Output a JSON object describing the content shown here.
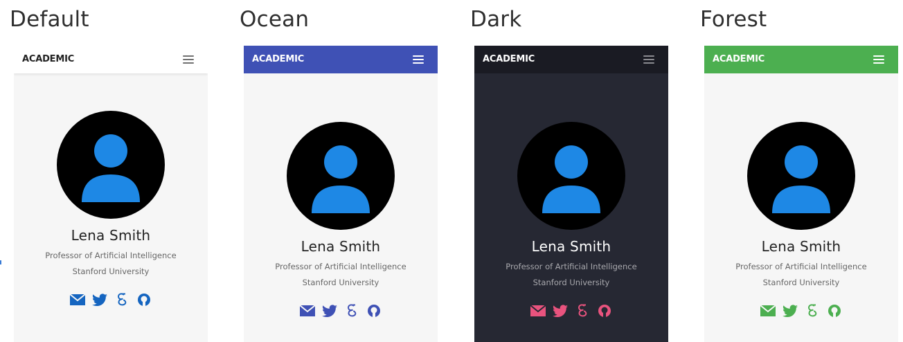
{
  "themes": [
    {
      "title": "Default",
      "brand": "ACADEMIC",
      "name": "Lena Smith",
      "role": "Professor of Artificial Intelligence",
      "organization": "Stanford University",
      "accent_color": "#1565c0",
      "navbar_color": "#ffffff",
      "background_color": "#f6f6f6",
      "social_icons": [
        "envelope-icon",
        "twitter-icon",
        "google-scholar-icon",
        "github-icon"
      ]
    },
    {
      "title": "Ocean",
      "brand": "ACADEMIC",
      "name": "Lena Smith",
      "role": "Professor of Artificial Intelligence",
      "organization": "Stanford University",
      "accent_color": "#3f51b5",
      "navbar_color": "#3f51b5",
      "background_color": "#f6f6f6",
      "social_icons": [
        "envelope-icon",
        "twitter-icon",
        "google-scholar-icon",
        "github-icon"
      ]
    },
    {
      "title": "Dark",
      "brand": "ACADEMIC",
      "name": "Lena Smith",
      "role": "Professor of Artificial Intelligence",
      "organization": "Stanford University",
      "accent_color": "#e9537e",
      "navbar_color": "#1a1b23",
      "background_color": "#262833",
      "social_icons": [
        "envelope-icon",
        "twitter-icon",
        "google-scholar-icon",
        "github-icon"
      ]
    },
    {
      "title": "Forest",
      "brand": "ACADEMIC",
      "name": "Lena Smith",
      "role": "Professor of Artificial Intelligence",
      "organization": "Stanford University",
      "accent_color": "#4caf50",
      "navbar_color": "#4caf50",
      "background_color": "#f6f6f6",
      "social_icons": [
        "envelope-icon",
        "twitter-icon",
        "google-scholar-icon",
        "github-icon"
      ]
    }
  ],
  "avatar_color": "#1e88e5"
}
